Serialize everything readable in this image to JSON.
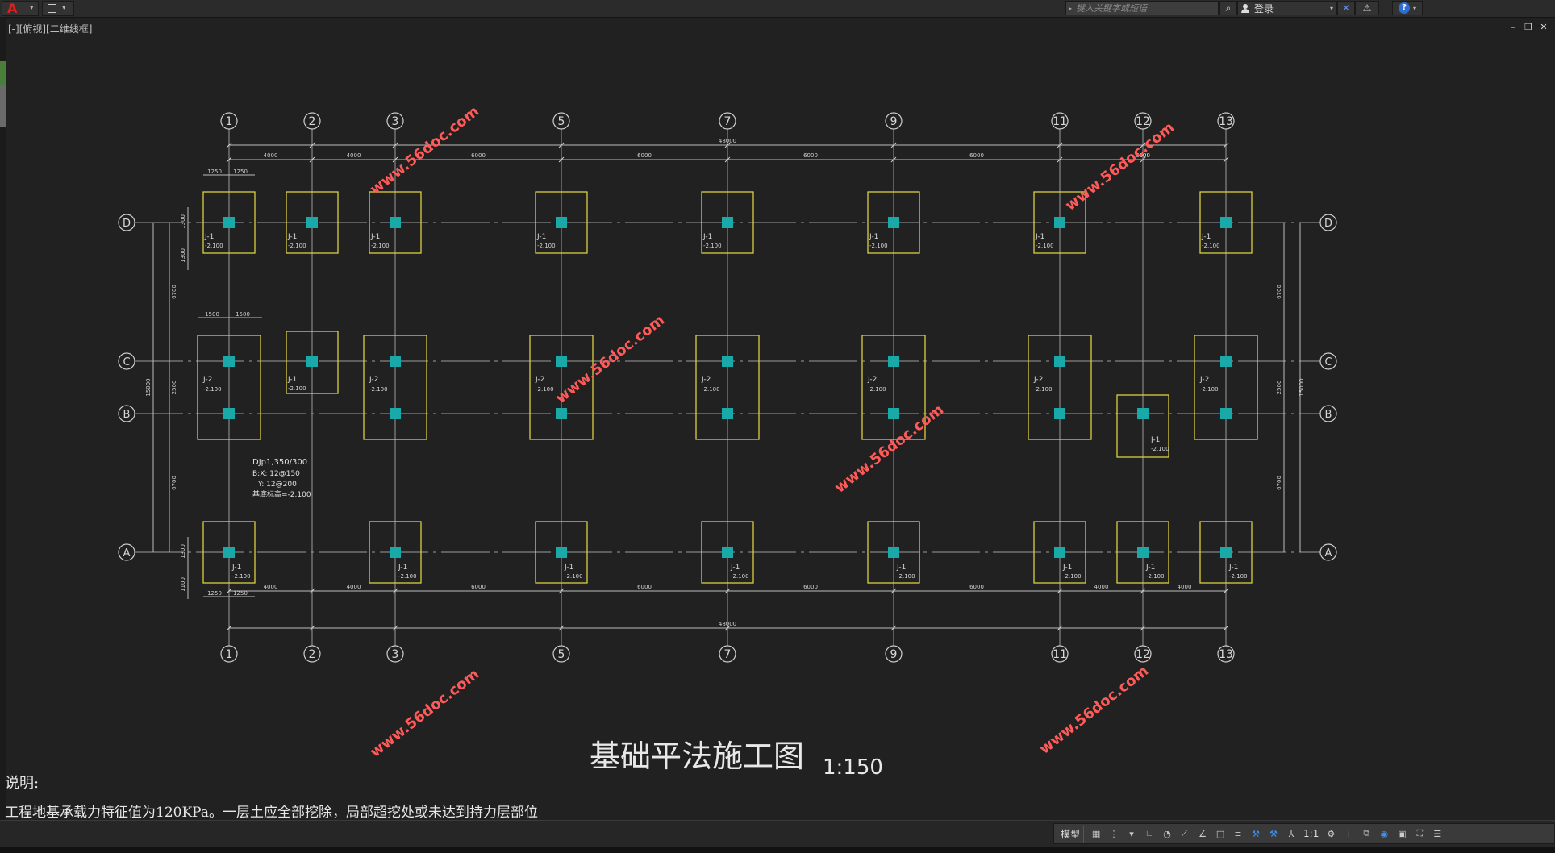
{
  "titlebar": {
    "app_logo": "A",
    "search_placeholder": "键入关键字或短语",
    "login_label": "登录"
  },
  "viewport": {
    "label": "[-][俯视][二维线框]"
  },
  "drawing": {
    "title": "基础平法施工图",
    "scale": "1:150",
    "watermark": "www.56doc.com",
    "axes_top": [
      "1",
      "2",
      "3",
      "5",
      "7",
      "9",
      "11",
      "12",
      "13"
    ],
    "axes_bottom": [
      "1",
      "2",
      "3",
      "5",
      "7",
      "9",
      "11",
      "12",
      "13"
    ],
    "rows": [
      "D",
      "C",
      "B",
      "A"
    ],
    "dims_top": [
      "4000",
      "4000",
      "6000",
      "6000",
      "6000",
      "6000",
      "6000",
      "4000"
    ],
    "dims_bottom": [
      "4000",
      "4000",
      "6000",
      "6000",
      "6000",
      "6000",
      "4000",
      "4000"
    ],
    "dim_total": "48000",
    "footing_j1": "J-1",
    "footing_j2": "J-2",
    "elev": "-2.100",
    "detail": {
      "line1": "DJp1,350/300",
      "line2": "B:X: 12@150",
      "line3": "Y: 12@200",
      "line4": "基底标高=-2.100"
    },
    "small_dims": {
      "d1250": "1250",
      "d1500": "1500",
      "d1300": "1300",
      "d1100": "1100",
      "d6700": "6700",
      "d2500": "2500",
      "d15000": "15000"
    }
  },
  "notes": {
    "title": "说明:",
    "line1": "工程地基承载力特征值为120KPa。一层土应全部挖除，局部超挖处或未达到持力层部位"
  },
  "statusbar": {
    "model_label": "模型",
    "scale_label": "1:1"
  }
}
